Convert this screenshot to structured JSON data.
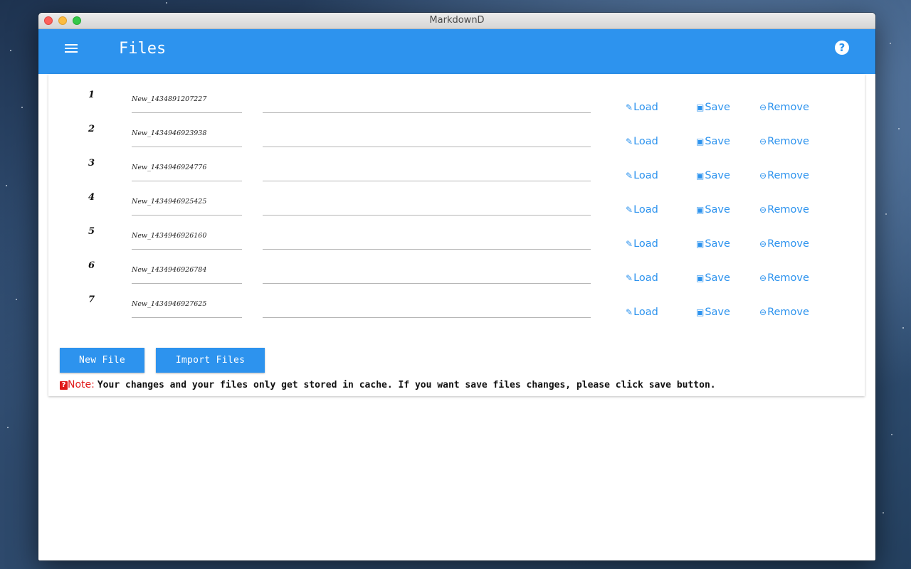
{
  "window": {
    "title": "MarkdownD"
  },
  "appbar": {
    "title": "Files",
    "help_glyph": "?"
  },
  "files": [
    {
      "num": "1",
      "name": "New_1434891207227",
      "description": ""
    },
    {
      "num": "2",
      "name": "New_1434946923938",
      "description": ""
    },
    {
      "num": "3",
      "name": "New_1434946924776",
      "description": ""
    },
    {
      "num": "4",
      "name": "New_1434946925425",
      "description": ""
    },
    {
      "num": "5",
      "name": "New_1434946926160",
      "description": ""
    },
    {
      "num": "6",
      "name": "New_1434946926784",
      "description": ""
    },
    {
      "num": "7",
      "name": "New_1434946927625",
      "description": ""
    }
  ],
  "actions": {
    "load": "Load",
    "save": "Save",
    "remove": "Remove"
  },
  "buttons": {
    "new_file": "New File",
    "import_files": "Import Files"
  },
  "note": {
    "icon_glyph": "?",
    "label": "Note:",
    "text": "Your changes and your files only get stored in cache. If you want save files changes, please click save button."
  },
  "icons": {
    "menu": "hamburger-menu-icon",
    "help": "help-circle-icon",
    "load": "pencil-icon",
    "save": "floppy-disk-icon",
    "remove": "minus-circle-icon",
    "note": "warning-icon"
  },
  "colors": {
    "accent": "#2d93ee",
    "note_red": "#e01919",
    "titlebar": "#e3e3e3"
  }
}
